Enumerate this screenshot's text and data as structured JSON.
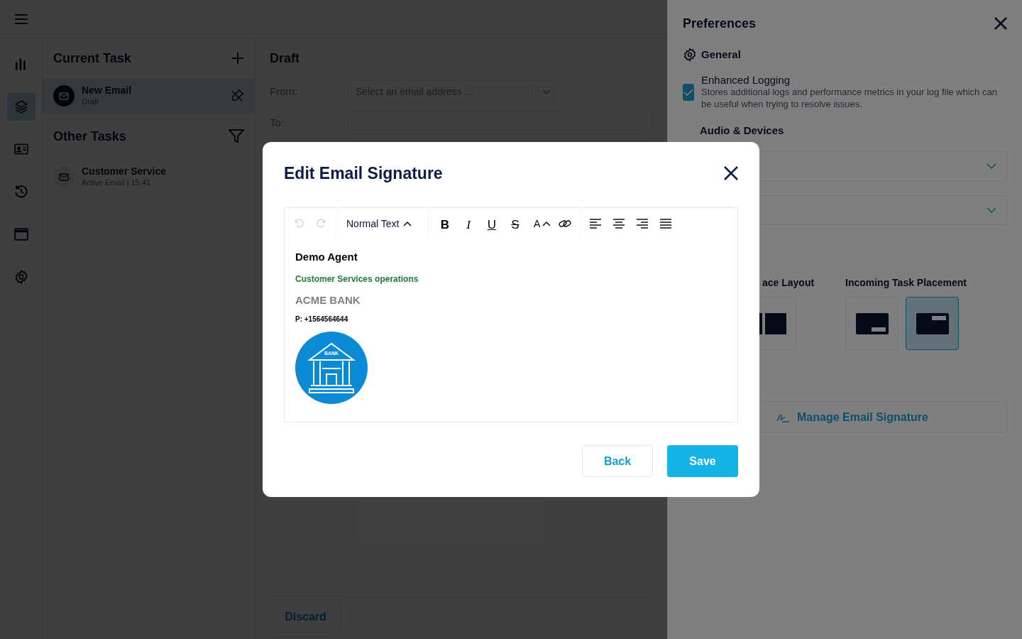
{
  "rail": [
    {
      "kind": "chart",
      "selected": false
    },
    {
      "kind": "layers",
      "selected": true
    },
    {
      "kind": "contact",
      "selected": false
    },
    {
      "kind": "history",
      "selected": false
    },
    {
      "kind": "window",
      "selected": false
    },
    {
      "kind": "settings",
      "selected": false
    }
  ],
  "current_task": {
    "title": "Current Task",
    "items": [
      {
        "title": "New Email",
        "subtitle": "Draft",
        "selected": true
      }
    ]
  },
  "other_tasks": {
    "title": "Other Tasks",
    "items": [
      {
        "title": "Customer Service",
        "subtitle": "Active Email | 15:41",
        "selected": false
      }
    ]
  },
  "draft": {
    "title": "Draft",
    "from_label": "From:",
    "from_placeholder": "Select an email address ...",
    "to_label": "To:",
    "discard": "Discard"
  },
  "preferences": {
    "title": "Preferences",
    "general": "General",
    "settings": [
      {
        "label": "Enhanced Logging",
        "description": "Stores additional logs and performance metrics in your log file which can be useful when trying to resolve issues.",
        "checked": true
      }
    ],
    "audio_heading": "Audio & Devices",
    "layout_heading": "ace Layout",
    "placement_heading": "Incoming Task Placement",
    "placement_options": [
      {
        "kind": "bottom",
        "selected": false
      },
      {
        "kind": "top",
        "selected": true
      }
    ],
    "manage_signature": "Manage Email Signature"
  },
  "modal": {
    "title": "Edit Email Signature",
    "toolbar": {
      "history": [
        {
          "kind": "undo",
          "disabled": true
        },
        {
          "kind": "redo",
          "disabled": true
        }
      ],
      "text_style": "Normal Text",
      "format": [
        {
          "kind": "bold",
          "label": "B"
        },
        {
          "kind": "italic",
          "label": "I"
        },
        {
          "kind": "underline",
          "label": "U"
        },
        {
          "kind": "strikethrough",
          "label": "S"
        }
      ],
      "font_size": "A"
    },
    "signature": {
      "name": "Demo Agent",
      "role": "Customer Services operations",
      "company": "ACME BANK",
      "phone": "P: +1564564644",
      "logo_text": "BANK"
    },
    "buttons": [
      {
        "label": "Back",
        "kind": "secondary"
      },
      {
        "label": "Save",
        "kind": "primary"
      }
    ]
  }
}
